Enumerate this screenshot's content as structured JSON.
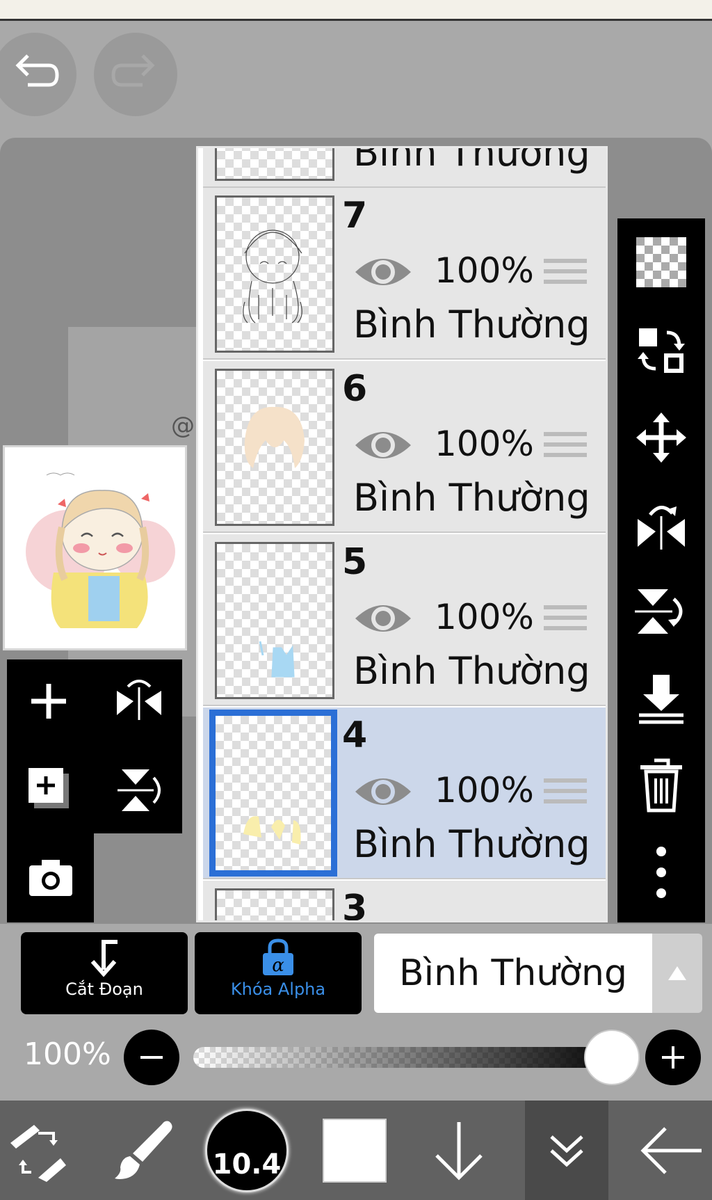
{
  "layers": [
    {
      "number": "7",
      "opacity": "100%",
      "blend": "Bình Thường",
      "selected": false
    },
    {
      "number": "6",
      "opacity": "100%",
      "blend": "Bình Thường",
      "selected": false
    },
    {
      "number": "5",
      "opacity": "100%",
      "blend": "Bình Thường",
      "selected": false
    },
    {
      "number": "4",
      "opacity": "100%",
      "blend": "Bình Thường",
      "selected": true
    }
  ],
  "partial_top_layer": {
    "blend": "Bình Thường"
  },
  "partial_bottom_layer": {
    "number": "3"
  },
  "clipping_button_label": "Cắt Đoạn",
  "alpha_lock_label": "Khóa Alpha",
  "blend_mode_value": "Bình Thường",
  "opacity_label": "100%",
  "opacity_slider_value": 1.0,
  "brush_size": "10.4",
  "colors": {
    "selection": "#2b6fd6",
    "alpha_lock": "#3a8fe8",
    "selected_layer_bg": "#ccd7ea"
  },
  "icons": [
    "undo-icon",
    "redo-icon",
    "add-layer-icon",
    "rotate-flip-icon",
    "duplicate-layer-icon",
    "flip-vertical-icon",
    "camera-icon",
    "transparency-icon",
    "swap-icon",
    "move-icon",
    "flip-horizontal-icon",
    "flip-vertical-icon",
    "merge-down-icon",
    "trash-icon",
    "more-icon",
    "selection-tool-icon",
    "brush-icon",
    "arrow-down-icon",
    "chevron-double-down-icon",
    "back-arrow-icon"
  ]
}
